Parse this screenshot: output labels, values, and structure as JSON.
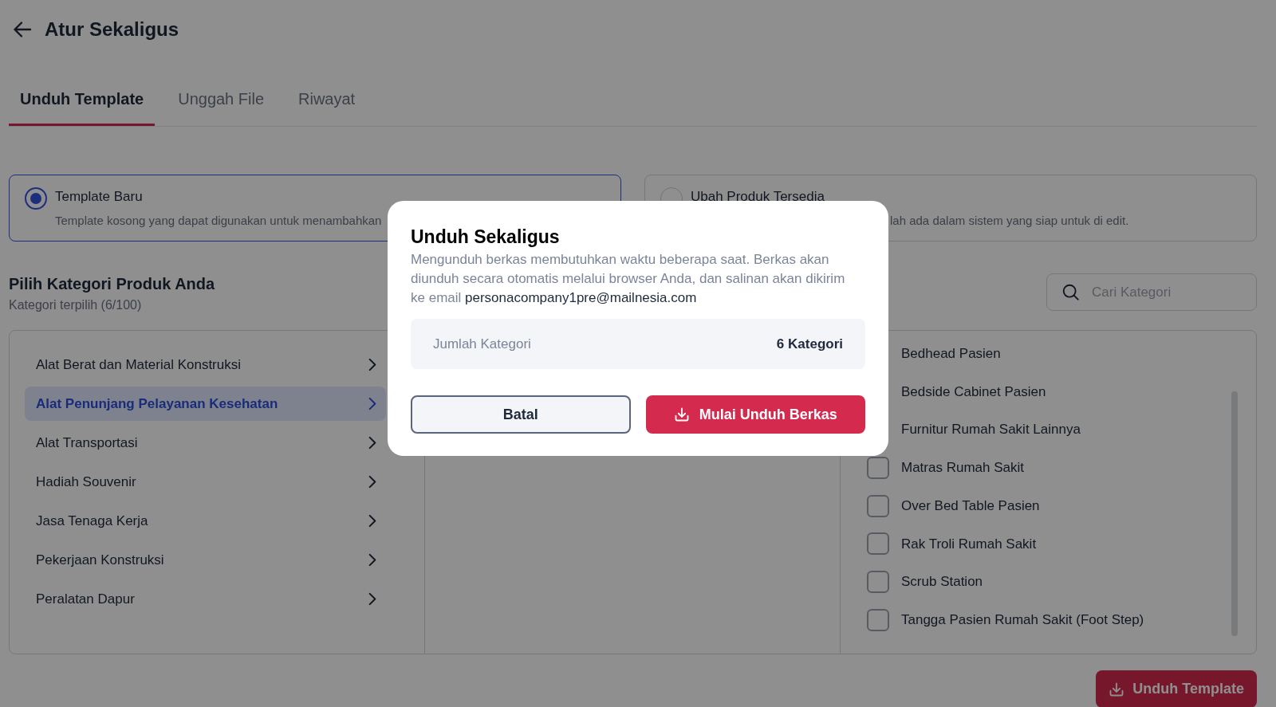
{
  "header": {
    "title": "Atur Sekaligus"
  },
  "tabs": [
    {
      "label": "Unduh Template",
      "selected": true
    },
    {
      "label": "Unggah File",
      "selected": false
    },
    {
      "label": "Riwayat",
      "selected": false
    }
  ],
  "template_options": [
    {
      "title": "Template Baru",
      "description": "Template kosong yang dapat digunakan untuk menambahkan",
      "selected": true
    },
    {
      "title": "Ubah Produk Tersedia",
      "description": "lah ada dalam sistem yang siap untuk di edit.",
      "selected": false
    }
  ],
  "category_section": {
    "title": "Pilih Kategori Produk Anda",
    "subtitle": "Kategori terpilih (6/100)",
    "search": {
      "placeholder": "Cari Kategori"
    },
    "categories": [
      {
        "label": "Alat Berat dan Material Konstruksi",
        "selected": false
      },
      {
        "label": "Alat Penunjang Pelayanan Kesehatan",
        "selected": true
      },
      {
        "label": "Alat Transportasi",
        "selected": false
      },
      {
        "label": "Hadiah Souvenir",
        "selected": false
      },
      {
        "label": "Jasa Tenaga Kerja",
        "selected": false
      },
      {
        "label": "Pekerjaan Konstruksi",
        "selected": false
      },
      {
        "label": "Peralatan Dapur",
        "selected": false
      }
    ],
    "subcategories": [
      {
        "label": "Bedhead Pasien"
      },
      {
        "label": "Bedside Cabinet Pasien"
      },
      {
        "label": "Furnitur Rumah Sakit Lainnya"
      },
      {
        "label": "Matras Rumah Sakit",
        "checked": false
      },
      {
        "label": "Over Bed Table Pasien",
        "checked": false
      },
      {
        "label": "Rak Troli Rumah Sakit",
        "checked": false
      },
      {
        "label": "Scrub Station",
        "checked": false
      },
      {
        "label": "Tangga Pasien Rumah Sakit (Foot Step)",
        "checked": false
      }
    ]
  },
  "footer_button": "Unduh Template",
  "dialog": {
    "title": "Unduh Sekaligus",
    "description": "Mengunduh berkas membutuhkan waktu beberapa saat. Berkas akan diunduh secara otomatis melalui browser Anda, dan salinan akan dikirim ke email",
    "email": "personacompany1pre@mailnesia.com",
    "summary": {
      "label": "Jumlah Kategori",
      "value": "6 Kategori"
    },
    "buttons": [
      {
        "label": "Batal",
        "kind": "secondary"
      },
      {
        "label": "Mulai Unduh Berkas",
        "kind": "primary"
      }
    ]
  }
}
